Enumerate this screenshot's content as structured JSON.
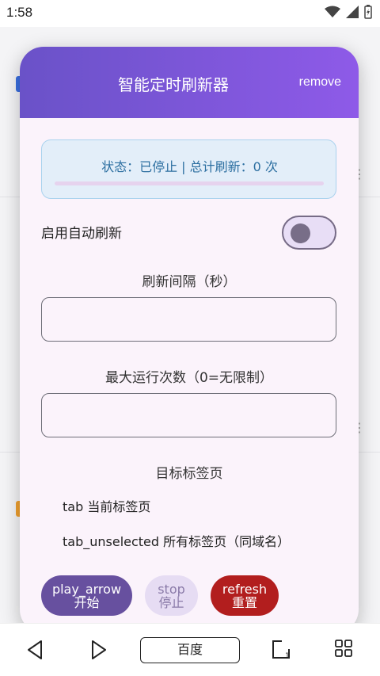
{
  "status_bar": {
    "time": "1:58"
  },
  "dialog": {
    "title": "智能定时刷新器",
    "remove_label": "remove",
    "status_text": "状态：已停止 | 总计刷新：0 次",
    "progress": 0,
    "auto_refresh_label": "启用自动刷新",
    "auto_refresh_enabled": false,
    "interval_label": "刷新间隔（秒）",
    "interval_value": "",
    "max_runs_label": "最大运行次数（0=无限制）",
    "max_runs_value": "",
    "target_label": "目标标签页",
    "target_options": [
      "tab 当前标签页",
      "tab_unselected 所有标签页（同域名）"
    ],
    "buttons": {
      "start_icon": "play_arrow",
      "start_label": "开始",
      "stop_icon": "stop",
      "stop_label": "停止",
      "reset_icon": "refresh",
      "reset_label": "重置"
    }
  },
  "bottom_bar": {
    "url_label": "百度"
  },
  "colors": {
    "header_start": "#6a52c8",
    "header_end": "#8e5ae8",
    "status_text": "#2b6ea0",
    "start_button": "#67509f",
    "reset_button": "#b21e1e"
  }
}
